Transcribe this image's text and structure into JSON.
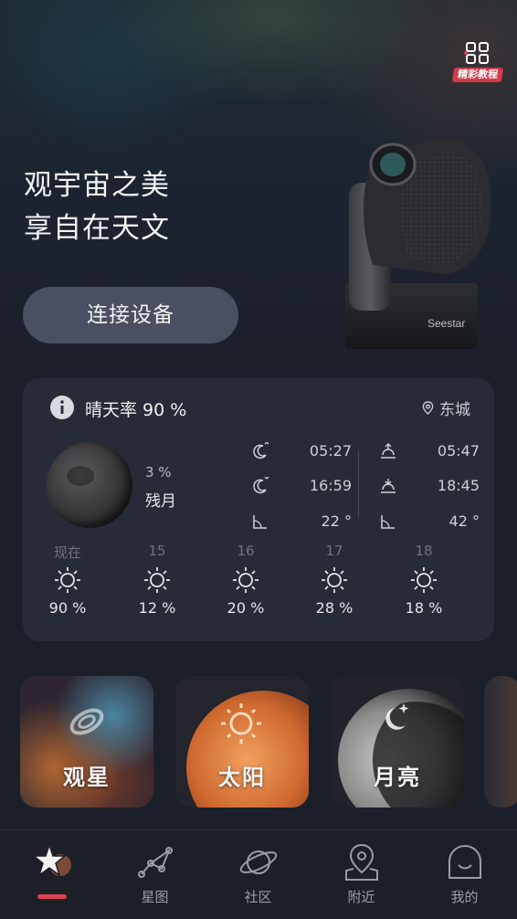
{
  "header": {
    "tutorial_badge": "精彩教程",
    "tutorial_icon": "grid-icon"
  },
  "hero": {
    "slogan_line1": "观宇宙之美",
    "slogan_line2": "享自在天文",
    "connect_button": "连接设备",
    "device_brand": "Seestar"
  },
  "weather": {
    "clear_rate": "晴天率 90 %",
    "location": "东城",
    "moon": {
      "illumination": "3 %",
      "phase": "残月"
    },
    "moonrise": "05:27",
    "moonset": "16:59",
    "moon_altitude": "22 °",
    "sunrise": "05:47",
    "sunset": "18:45",
    "sun_altitude": "42 °",
    "forecast": [
      {
        "label": "现在",
        "value": "90 %",
        "icon": "sun-icon"
      },
      {
        "label": "15",
        "value": "12 %",
        "icon": "sun-icon"
      },
      {
        "label": "16",
        "value": "20 %",
        "icon": "sun-icon"
      },
      {
        "label": "17",
        "value": "28 %",
        "icon": "sun-icon"
      },
      {
        "label": "18",
        "value": "18 %",
        "icon": "sun-icon"
      }
    ]
  },
  "cards": [
    {
      "label": "观星"
    },
    {
      "label": "太阳"
    },
    {
      "label": "月亮"
    }
  ],
  "tabs": [
    {
      "label": "",
      "icon": "home-star-icon",
      "active": true
    },
    {
      "label": "星图",
      "icon": "constellation-icon"
    },
    {
      "label": "社区",
      "icon": "planet-icon"
    },
    {
      "label": "附近",
      "icon": "map-pin-icon"
    },
    {
      "label": "我的",
      "icon": "profile-icon"
    }
  ],
  "colors": {
    "accent": "#e0404f",
    "card_bg": "#272b37",
    "button_bg": "#4a4f61"
  }
}
